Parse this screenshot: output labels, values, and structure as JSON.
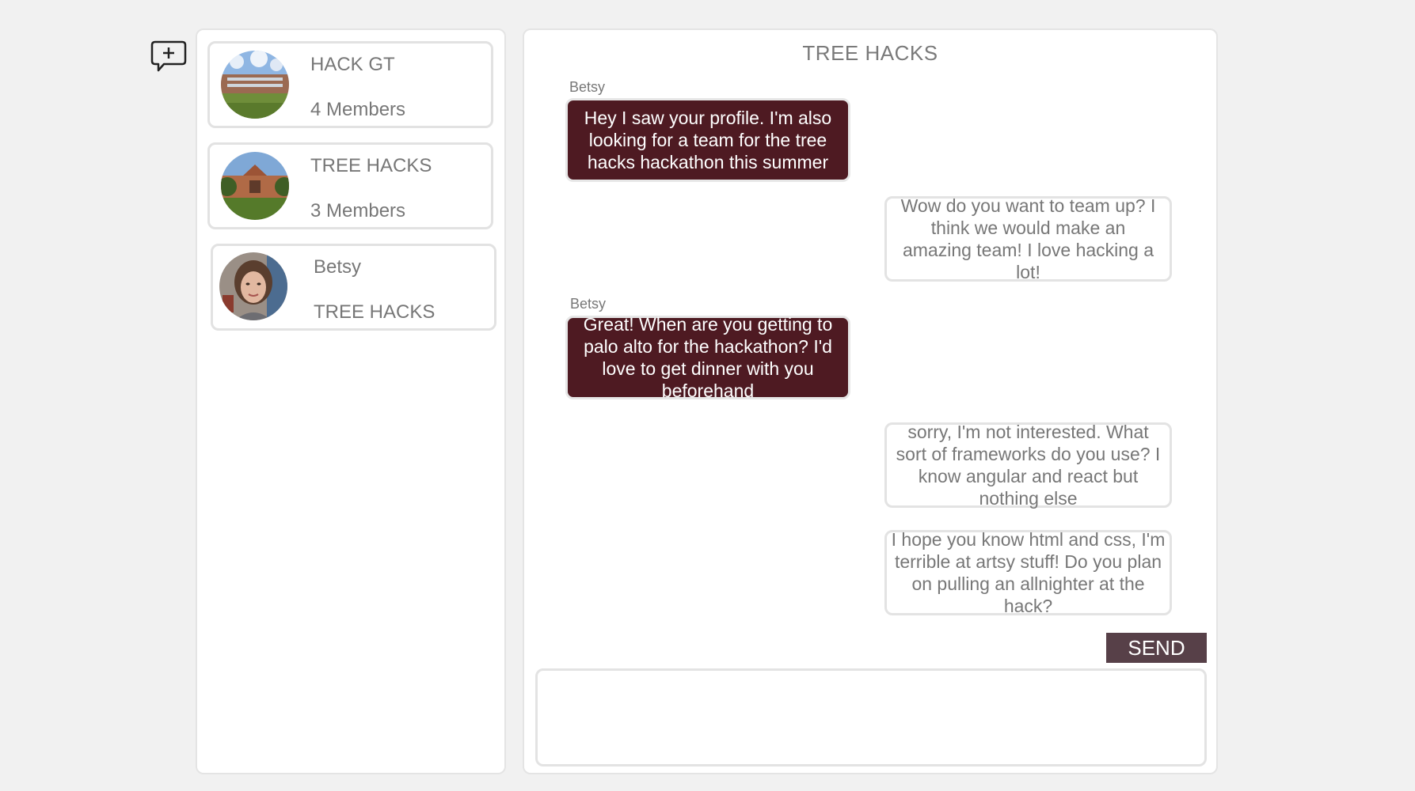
{
  "icons": {
    "new_chat": "chat-plus-icon"
  },
  "colors": {
    "incoming_bubble": "#4e1a22",
    "send_button": "#574048",
    "background": "#f1f1f1"
  },
  "conversations": [
    {
      "line1": "HACK GT",
      "line2": "4 Members",
      "avatar": "campus-building-photo"
    },
    {
      "line1": "TREE HACKS",
      "line2": "3 Members",
      "avatar": "stanford-quad-photo"
    },
    {
      "line1": "Betsy",
      "line2": "TREE HACKS",
      "avatar": "betsy-portrait-photo"
    }
  ],
  "chat": {
    "title": "TREE HACKS",
    "messages": [
      {
        "sender": "Betsy",
        "direction": "in",
        "text": "Hey I saw your profile. I'm also looking for a team for the tree hacks hackathon this summer"
      },
      {
        "sender": "",
        "direction": "out",
        "text": "Wow do you want to team up? I think we would make an amazing team! I love hacking a lot!"
      },
      {
        "sender": "Betsy",
        "direction": "in",
        "text": "Great! When are you getting to palo alto for the hackathon? I'd love to get dinner with you beforehand"
      },
      {
        "sender": "",
        "direction": "out",
        "text": "sorry, I'm not interested. What sort of frameworks do you use? I know angular and react but nothing else"
      },
      {
        "sender": "",
        "direction": "out",
        "text": "I hope you know html and css, I'm terrible at artsy stuff! Do you plan on pulling an allnighter at the hack?"
      }
    ],
    "send_label": "SEND",
    "input_value": ""
  }
}
